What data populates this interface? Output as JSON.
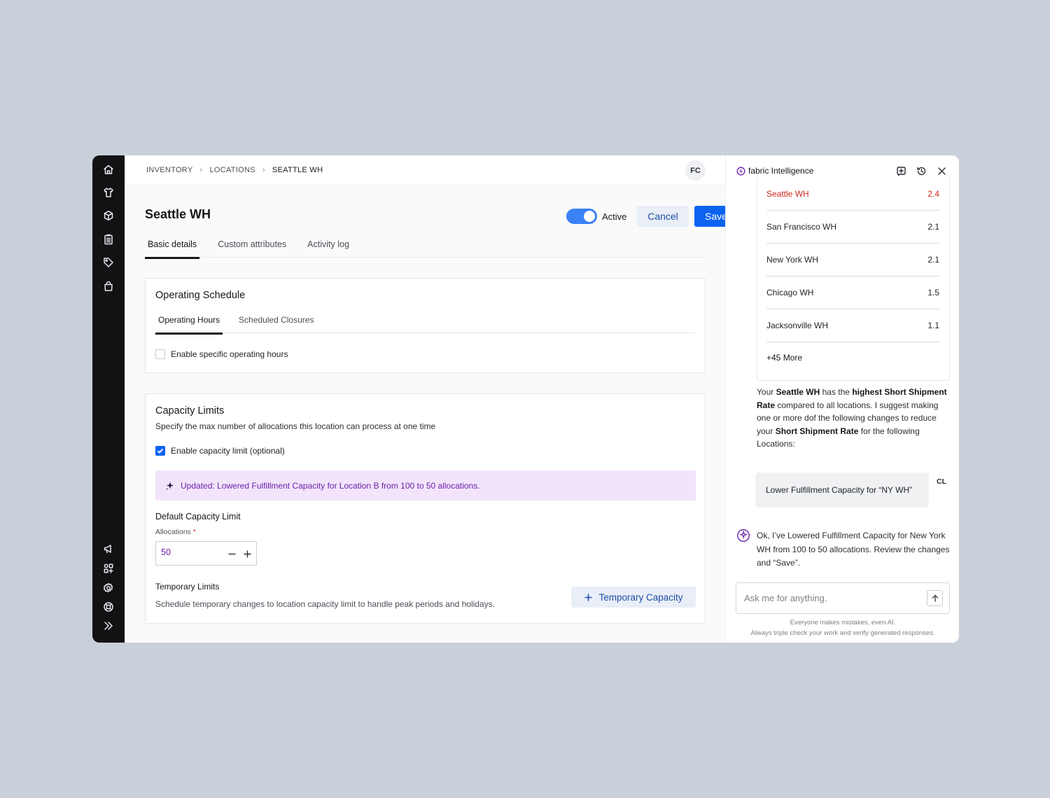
{
  "breadcrumb": {
    "item1": "INVENTORY",
    "item2": "LOCATIONS",
    "item3": "SEATTLE WH"
  },
  "user": {
    "initials": "FC"
  },
  "page": {
    "title": "Seattle WH",
    "status_label": "Active",
    "status_on": true,
    "cancel_label": "Cancel",
    "save_label": "Save"
  },
  "tabs": [
    "Basic details",
    "Custom attributes",
    "Activity log"
  ],
  "operating_schedule": {
    "title": "Operating Schedule",
    "subtabs": [
      "Operating Hours",
      "Scheduled Closures"
    ],
    "checkbox_label": "Enable specific operating hours",
    "checkbox_checked": false
  },
  "capacity": {
    "title": "Capacity Limits",
    "description": "Specify the max number of allocations this location can process at one time",
    "checkbox_label": "Enable capacity limit (optional)",
    "checkbox_checked": true,
    "banner_text": "Updated: Lowered Fulfillment Capacity for Location B from 100 to 50 allocations.",
    "default_label": "Default Capacity Limit",
    "field_label": "Allocations",
    "required_mark": "*",
    "field_value": "50",
    "temp_title": "Temporary Limits",
    "temp_description": "Schedule temporary changes to location capacity limit to handle peak periods and holidays.",
    "temp_button": "Temporary Capacity"
  },
  "ai": {
    "brand": "fabric Intelligence",
    "rates": [
      {
        "name": "Seattle WH",
        "value": "2.4",
        "highlight": true
      },
      {
        "name": "San Francisco WH",
        "value": "2.1"
      },
      {
        "name": "New York WH",
        "value": "2.1"
      },
      {
        "name": "Chicago WH",
        "value": "1.5"
      },
      {
        "name": "Jacksonville WH",
        "value": "1.1"
      }
    ],
    "more": "+45 More",
    "message": {
      "p1": "Your ",
      "b1": "Seattle WH",
      "p2": " has the ",
      "b2": "highest Short Shipment Rate",
      "p3": " compared to all locations. I suggest making one or more dof the following changes to reduce your ",
      "b3": "Short Shipment Rate",
      "p4": " for the following Locations:"
    },
    "user_message": "Lower Fulfillment Capacity for “NY WH”",
    "user_initials": "CL",
    "reply": "Ok, I’ve Lowered Fulfillment Capacity for New York WH from 100 to 50 allocations. Review the changes and “Save”.",
    "input_placeholder": "Ask me for anything.",
    "disclaimer1": "Everyone makes mistakes, even AI.",
    "disclaimer2": "Always triple check your work and verify generated responses."
  },
  "colors": {
    "accent": "#0b63f0",
    "highlight_red": "#d2261c",
    "banner_bg": "#f2e4fb",
    "banner_text": "#6b21a8"
  },
  "icons": {
    "sidebar_top": [
      "home-icon",
      "shirt-icon",
      "box-icon",
      "clipboard-icon",
      "tag-icon",
      "bag-icon"
    ],
    "sidebar_bottom": [
      "megaphone-icon",
      "apps-icon",
      "gear-icon",
      "help-icon",
      "expand-icon"
    ]
  }
}
